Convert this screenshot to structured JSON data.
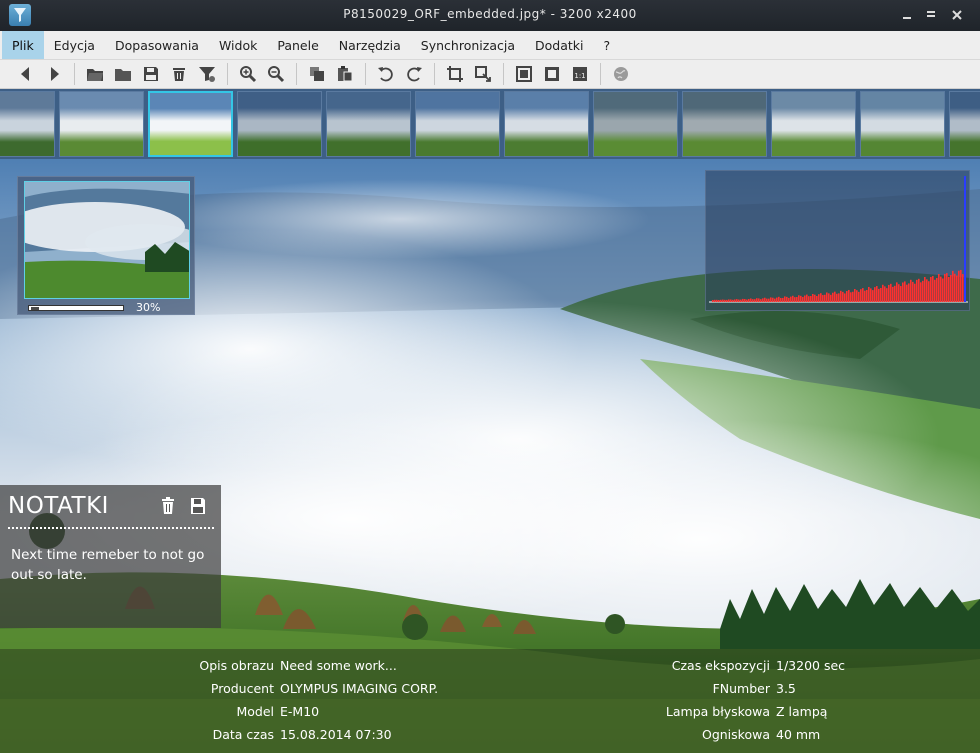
{
  "window": {
    "title": "P8150029_ORF_embedded.jpg* - 3200 x2400",
    "controls": [
      "minimize",
      "maximize",
      "close"
    ]
  },
  "menubar": {
    "items": [
      {
        "label": "Plik",
        "active": true
      },
      {
        "label": "Edycja"
      },
      {
        "label": "Dopasowania"
      },
      {
        "label": "Widok"
      },
      {
        "label": "Panele"
      },
      {
        "label": "Narzędzia"
      },
      {
        "label": "Synchronizacja"
      },
      {
        "label": "Dodatki"
      },
      {
        "label": "?"
      }
    ]
  },
  "toolbar": {
    "groups": [
      [
        "back-icon",
        "forward-icon"
      ],
      [
        "open-folder-icon",
        "open-file-icon",
        "save-icon",
        "delete-icon",
        "filter-icon"
      ],
      [
        "zoom-in-icon",
        "zoom-out-icon"
      ],
      [
        "copy-icon",
        "paste-icon"
      ],
      [
        "rotate-left-icon",
        "rotate-right-icon"
      ],
      [
        "crop-icon",
        "resize-icon"
      ],
      [
        "fit-window-icon",
        "fullscreen-icon",
        "actual-size-icon"
      ],
      [
        "globe-icon"
      ]
    ]
  },
  "thumbnails": {
    "count": 12,
    "selected_index": 2
  },
  "navigator": {
    "zoom_label": "30%",
    "zoom_fraction": 0.3
  },
  "notes": {
    "title": "NOTATKI",
    "text": "Next time remeber to not go out so late."
  },
  "info": {
    "left": [
      {
        "label": "Opis obrazu",
        "value": "Need some work..."
      },
      {
        "label": "Producent",
        "value": "OLYMPUS IMAGING CORP."
      },
      {
        "label": "Model",
        "value": "E-M10"
      },
      {
        "label": "Data czas",
        "value": "15.08.2014 07:30"
      }
    ],
    "right": [
      {
        "label": "Czas ekspozycji",
        "value": "1/3200 sec"
      },
      {
        "label": "FNumber",
        "value": "3.5"
      },
      {
        "label": "Lampa błyskowa",
        "value": "Z lampą"
      },
      {
        "label": "Ogniskowa",
        "value": "40 mm"
      }
    ]
  },
  "colors": {
    "selection": "#34c6e6",
    "menu_active": "#a9d3ea",
    "strip_bg": "#3d5f86"
  }
}
